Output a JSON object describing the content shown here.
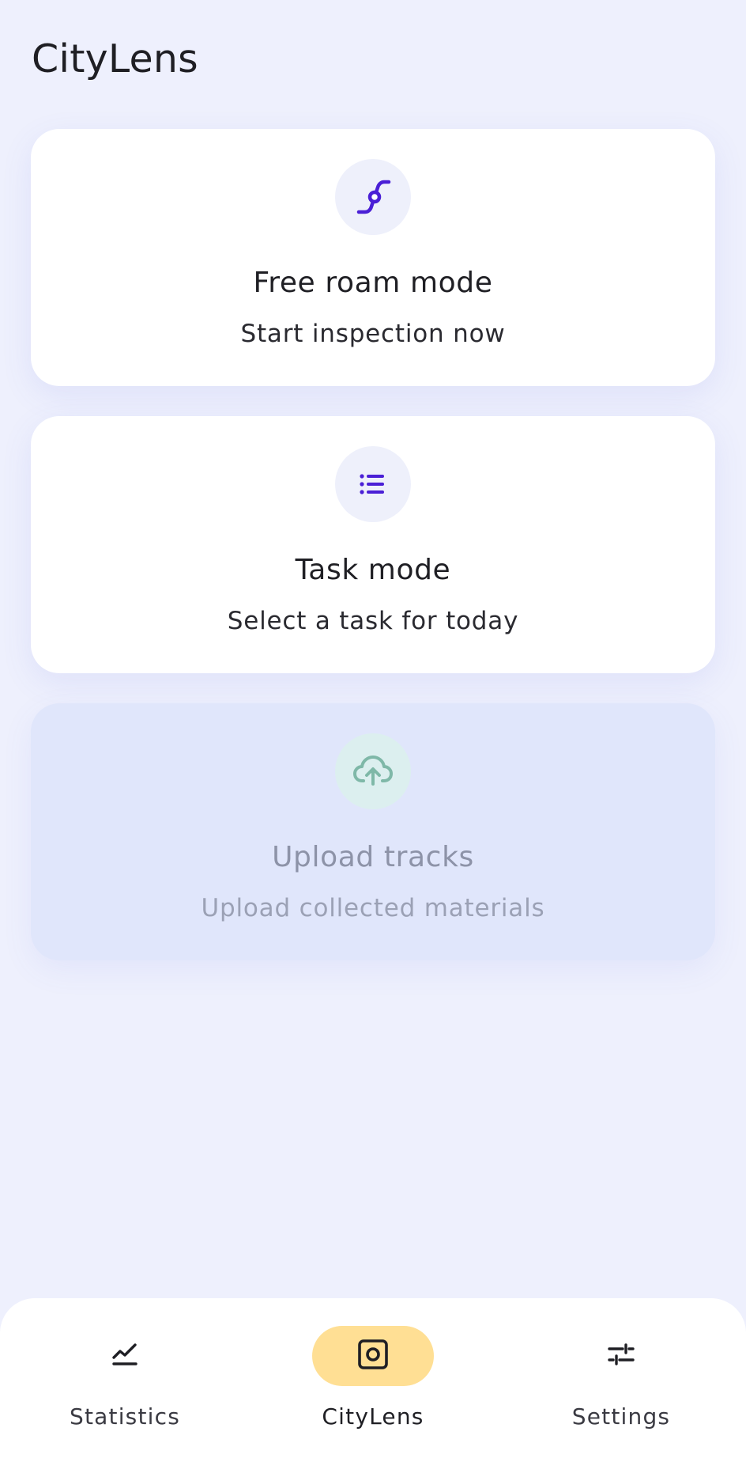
{
  "app": {
    "title": "CityLens"
  },
  "colors": {
    "accent": "#4a1fd6",
    "background": "#eef0fd",
    "card": "#ffffff",
    "card_disabled": "#e0e6fb",
    "upload_icon": "#7fb8a8",
    "nav_active_pill": "#ffdf94"
  },
  "cards": [
    {
      "icon": "route-icon",
      "title": "Free roam mode",
      "subtitle": "Start inspection now",
      "enabled": true
    },
    {
      "icon": "list-icon",
      "title": "Task mode",
      "subtitle": "Select a task for today",
      "enabled": true
    },
    {
      "icon": "cloud-upload-icon",
      "title": "Upload tracks",
      "subtitle": "Upload collected materials",
      "enabled": false
    }
  ],
  "nav": {
    "items": [
      {
        "icon": "chart-line-icon",
        "label": "Statistics",
        "active": false
      },
      {
        "icon": "camera-lens-icon",
        "label": "CityLens",
        "active": true
      },
      {
        "icon": "sliders-icon",
        "label": "Settings",
        "active": false
      }
    ]
  }
}
